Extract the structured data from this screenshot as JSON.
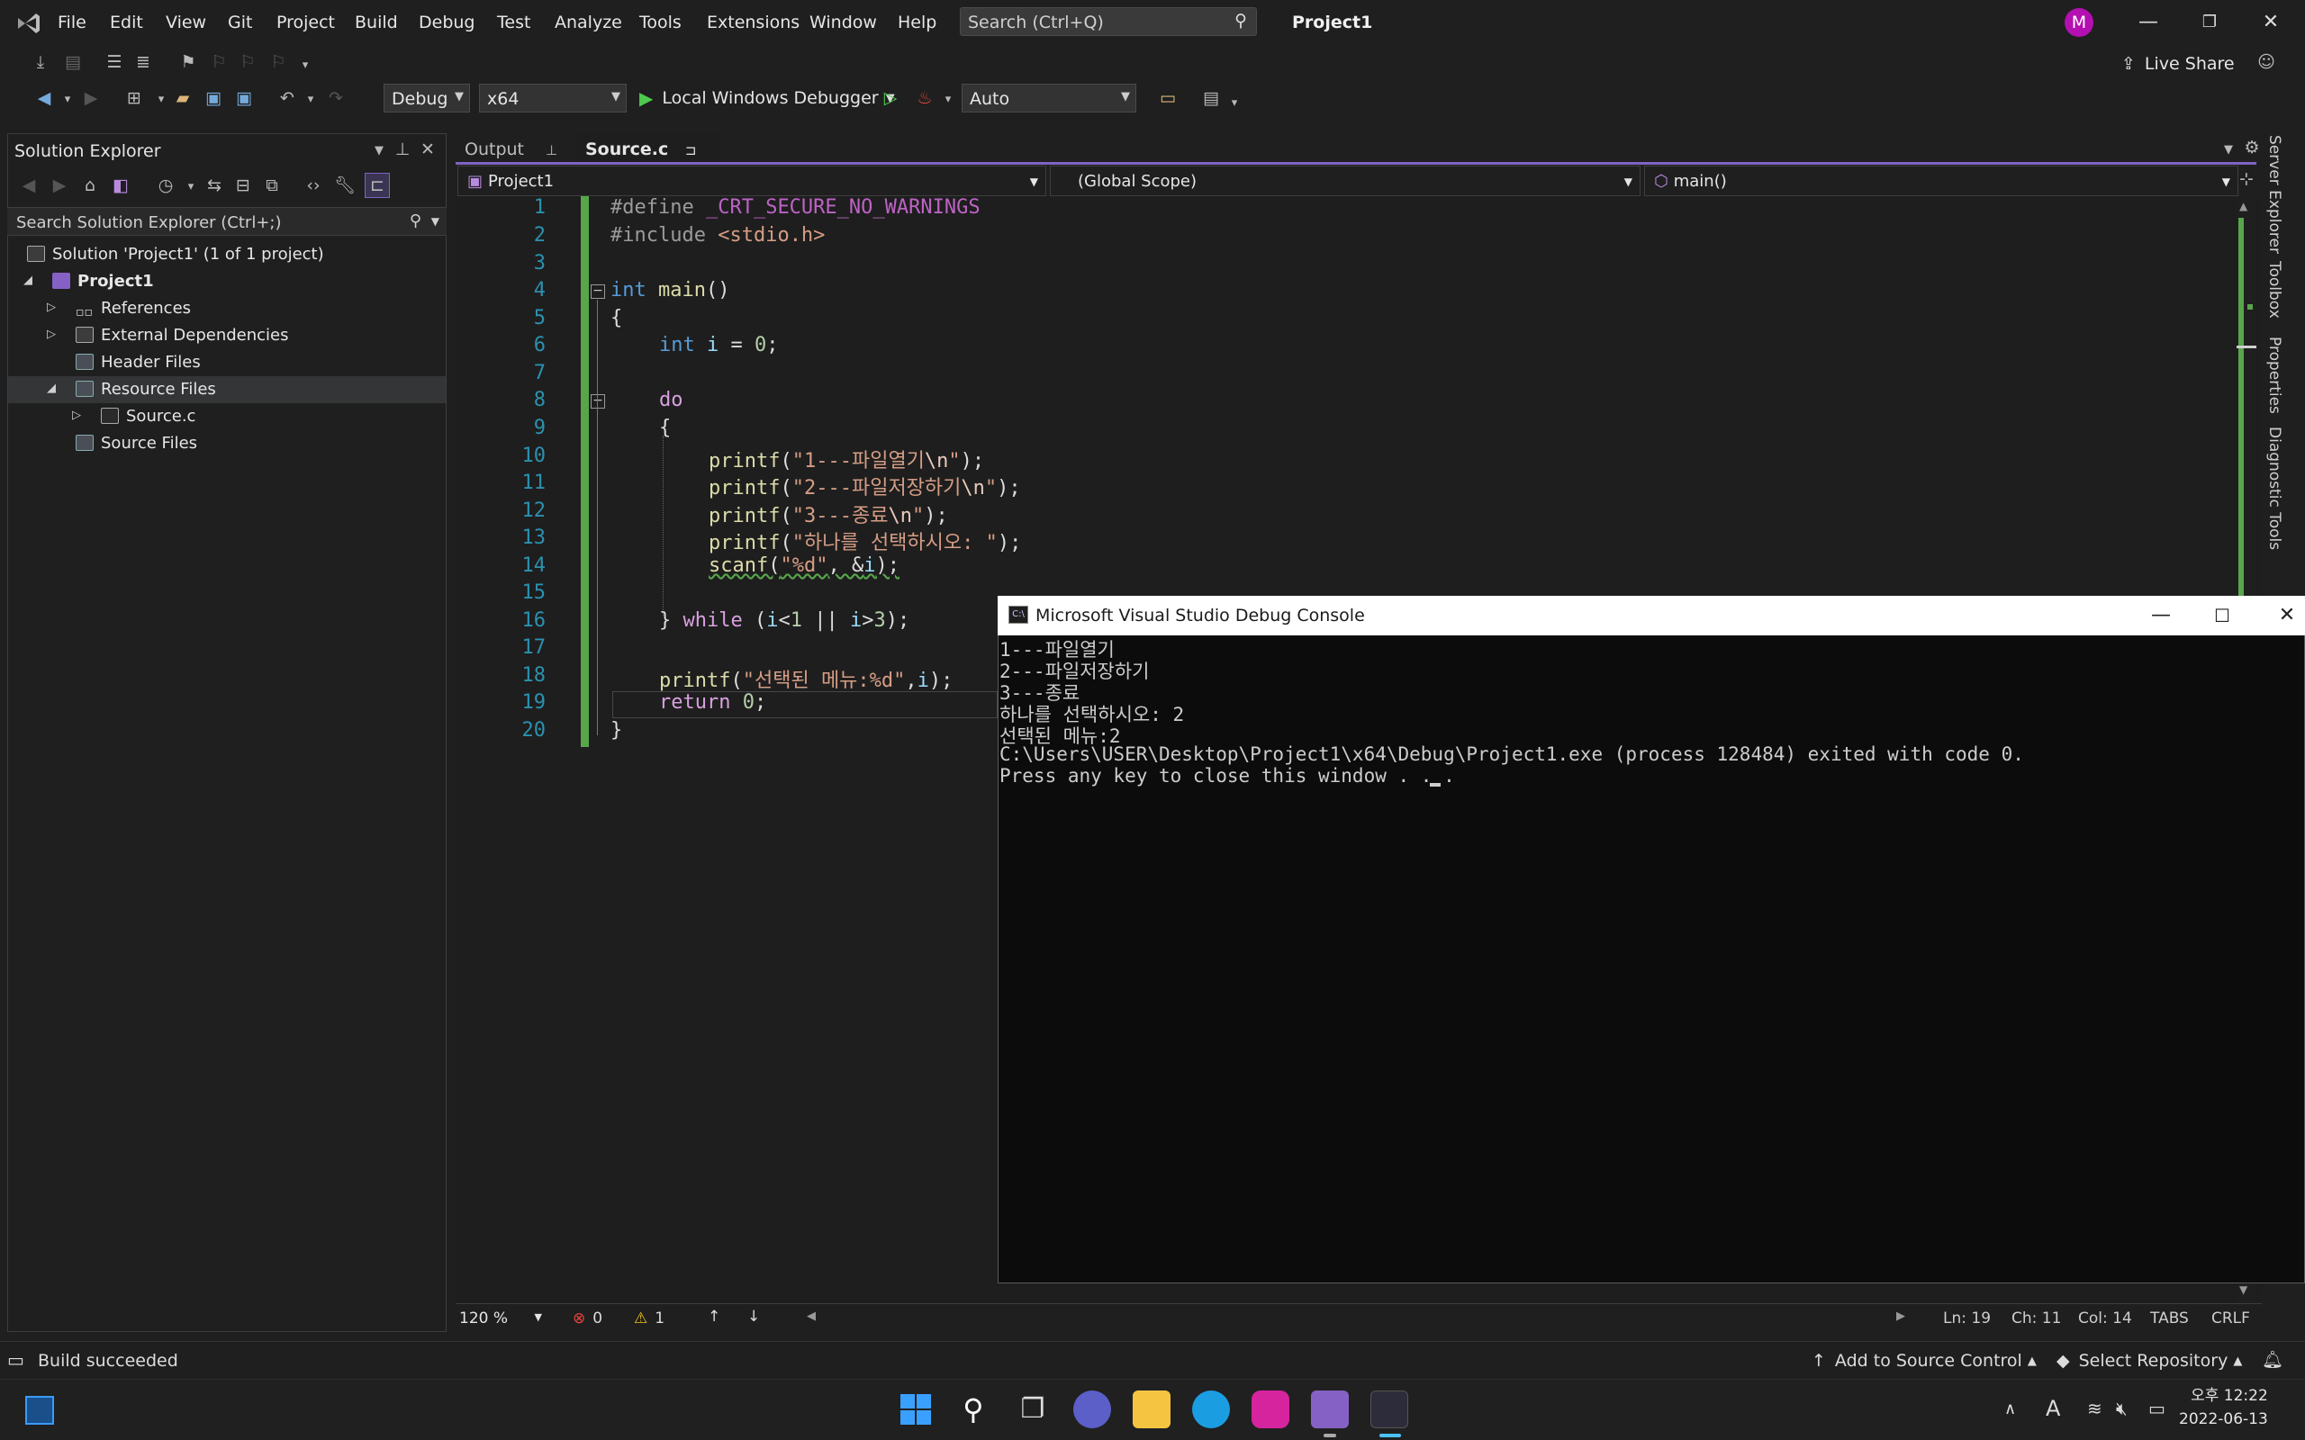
{
  "window": {
    "title": "Project1",
    "search_placeholder": "Search (Ctrl+Q)",
    "avatar_initial": "M",
    "live_share": "Live Share"
  },
  "menu": [
    "File",
    "Edit",
    "View",
    "Git",
    "Project",
    "Build",
    "Debug",
    "Test",
    "Analyze",
    "Tools",
    "Extensions",
    "Window",
    "Help"
  ],
  "toolbar": {
    "config": "Debug",
    "platform": "x64",
    "debugger": "Local Windows Debugger",
    "auto": "Auto"
  },
  "solution_explorer": {
    "title": "Solution Explorer",
    "search_placeholder": "Search Solution Explorer (Ctrl+;)",
    "items": [
      {
        "label": "Solution 'Project1'  (1 of 1 project)"
      },
      {
        "label": "Project1"
      },
      {
        "label": "References"
      },
      {
        "label": "External Dependencies"
      },
      {
        "label": "Header Files"
      },
      {
        "label": "Resource Files"
      },
      {
        "label": "Source.c"
      },
      {
        "label": "Source Files"
      }
    ]
  },
  "tabs": [
    {
      "label": "Output"
    },
    {
      "label": "Source.c"
    }
  ],
  "nav": {
    "project": "Project1",
    "scope": "(Global Scope)",
    "member": "main()"
  },
  "code": {
    "line_numbers": [
      "1",
      "2",
      "3",
      "4",
      "5",
      "6",
      "7",
      "8",
      "9",
      "10",
      "11",
      "12",
      "13",
      "14",
      "15",
      "16",
      "17",
      "18",
      "19",
      "20"
    ],
    "l1a": "#define ",
    "l1b": "_CRT_SECURE_NO_WARNINGS",
    "l2a": "#include ",
    "l2b": "<stdio.h>",
    "l4a": "int ",
    "l4b": "main",
    "l4c": "()",
    "l5": "{",
    "l6a": "int ",
    "l6b": "i",
    "l6c": " = ",
    "l6d": "0",
    "l6e": ";",
    "l8": "do",
    "l9": "{",
    "l10a": "printf",
    "l10b": "(",
    "l10c": "\"1---파일열기",
    "l10d": "\\n",
    "l10e": "\"",
    "l10f": ");",
    "l11a": "printf",
    "l11b": "(",
    "l11c": "\"2---파일저장하기",
    "l11d": "\\n",
    "l11e": "\"",
    "l11f": ");",
    "l12a": "printf",
    "l12b": "(",
    "l12c": "\"3---종료",
    "l12d": "\\n",
    "l12e": "\"",
    "l12f": ");",
    "l13a": "printf",
    "l13b": "(",
    "l13c": "\"하나를 선택하시오: \"",
    "l13d": ");",
    "l14a": "scanf",
    "l14b": "(",
    "l14c": "\"%d\"",
    "l14d": ", &",
    "l14e": "i",
    "l14f": ");",
    "l16a": "} ",
    "l16b": "while",
    "l16c": " (",
    "l16d": "i",
    "l16e": "<",
    "l16f": "1",
    "l16g": " || ",
    "l16h": "i",
    "l16i": ">",
    "l16j": "3",
    "l16k": ");",
    "l18a": "printf",
    "l18b": "(",
    "l18c": "\"선택된 메뉴:%d\"",
    "l18d": ",",
    "l18e": "i",
    "l18f": ");",
    "l19a": "return ",
    "l19b": "0",
    "l19c": ";",
    "l20": "}"
  },
  "console": {
    "title": "Microsoft Visual Studio Debug Console",
    "lines": [
      "1---파일열기",
      "2---파일저장하기",
      "3---종료",
      "하나를 선택하시오: 2",
      "선택된 메뉴:2",
      "C:\\Users\\USER\\Desktop\\Project1\\x64\\Debug\\Project1.exe (process 128484) exited with code 0.",
      "Press any key to close this window . . ."
    ]
  },
  "editor_status": {
    "zoom": "120 %",
    "errors": "0",
    "warnings": "1",
    "ln": "Ln: 19",
    "ch": "Ch: 11",
    "col": "Col: 14",
    "tabs": "TABS",
    "eol": "CRLF"
  },
  "status": {
    "message": "Build succeeded",
    "source_control": "Add to Source Control",
    "repository": "Select Repository"
  },
  "side_tabs": [
    "Server Explorer",
    "Toolbox",
    "Properties",
    "Diagnostic Tools"
  ],
  "clock": {
    "time": "오후 12:22",
    "date": "2022-06-13"
  },
  "colors": {
    "accent": "#7e63c4",
    "green_bar": "#57a64a",
    "vs_purple": "#8661c5"
  }
}
